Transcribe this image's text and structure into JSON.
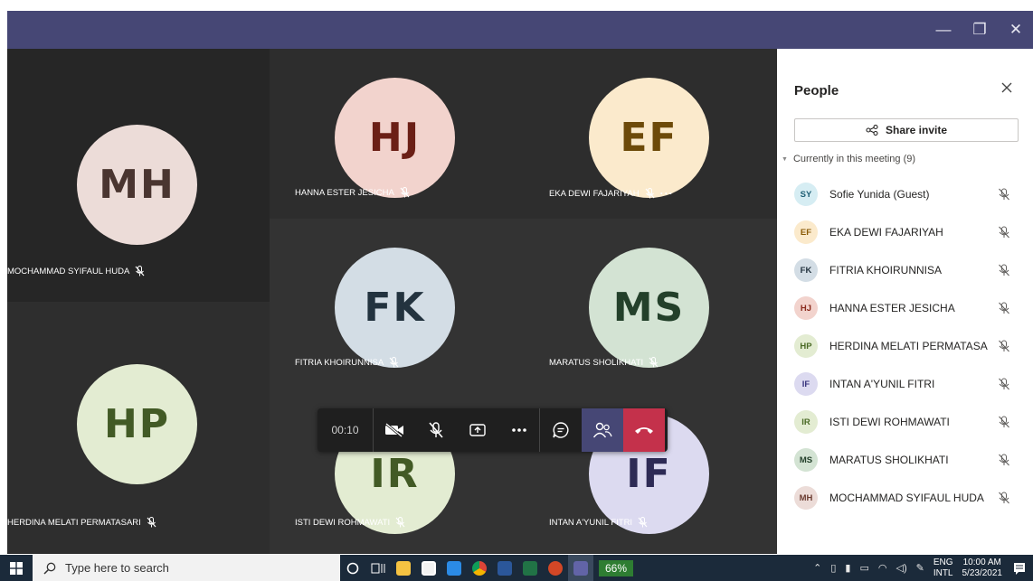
{
  "window": {
    "minimize": "—",
    "restore": "❐",
    "close": "✕"
  },
  "tiles": [
    {
      "initials": "MH",
      "name": "MOCHAMMAD SYIFAUL HUDA",
      "bg": "#262626",
      "circle": "#ecdcd8",
      "fg": "#4a3530"
    },
    {
      "initials": "HJ",
      "name": "HANNA ESTER JESICHA",
      "bg": "#2d2d2d",
      "circle": "#f2d3cd",
      "fg": "#6b1f16"
    },
    {
      "initials": "EF",
      "name": "EKA DEWI FAJARIYAH",
      "bg": "#2d2d2d",
      "circle": "#fbeacc",
      "fg": "#6d4a09"
    },
    {
      "initials": "FK",
      "name": "FITRIA KHOIRUNNISA",
      "bg": "#333333",
      "circle": "#d3dde5",
      "fg": "#23333f"
    },
    {
      "initials": "MS",
      "name": "MARATUS SHOLIKHATI",
      "bg": "#333333",
      "circle": "#d3e3d3",
      "fg": "#23402a"
    },
    {
      "initials": "HP",
      "name": "HERDINA MELATI PERMATASARI",
      "bg": "#2e2e2e",
      "circle": "#e3ecd2",
      "fg": "#425a25"
    },
    {
      "initials": "IR",
      "name": "ISTI DEWI ROHMAWATI",
      "bg": "#333333",
      "circle": "#e3ecd2",
      "fg": "#425a25"
    },
    {
      "initials": "IF",
      "name": "INTAN A'YUNIL FITRI",
      "bg": "#333333",
      "circle": "#dcdaf0",
      "fg": "#2d2a55"
    }
  ],
  "callbar": {
    "timer": "00:10"
  },
  "people": {
    "title": "People",
    "share_label": "Share invite",
    "section": "Currently in this meeting (9)",
    "members": [
      {
        "initials": "SY",
        "name": "Sofie Yunida (Guest)",
        "bg": "#d6edf3",
        "fg": "#1f5f75"
      },
      {
        "initials": "EF",
        "name": "EKA DEWI FAJARIYAH",
        "bg": "#fbeacc",
        "fg": "#8a5b06"
      },
      {
        "initials": "FK",
        "name": "FITRIA KHOIRUNNISA",
        "bg": "#d3dde5",
        "fg": "#23333f"
      },
      {
        "initials": "HJ",
        "name": "HANNA ESTER JESICHA",
        "bg": "#f2d3cd",
        "fg": "#8a2a1d"
      },
      {
        "initials": "HP",
        "name": "HERDINA MELATI PERMATASA",
        "bg": "#e3ecd2",
        "fg": "#4a6a25"
      },
      {
        "initials": "IF",
        "name": "INTAN A'YUNIL FITRI",
        "bg": "#dcdaf0",
        "fg": "#3a3680"
      },
      {
        "initials": "IR",
        "name": "ISTI DEWI ROHMAWATI",
        "bg": "#e3ecd2",
        "fg": "#4a6a25"
      },
      {
        "initials": "MS",
        "name": "MARATUS SHOLIKHATI",
        "bg": "#d3e3d3",
        "fg": "#23402a"
      },
      {
        "initials": "MH",
        "name": "MOCHAMMAD SYIFAUL HUDA",
        "bg": "#ecdcd8",
        "fg": "#6b3b30"
      }
    ]
  },
  "taskbar": {
    "search_placeholder": "Type here to search",
    "battery": "66%",
    "lang_top": "ENG",
    "lang_bottom": "INTL",
    "time": "10:00 AM",
    "date": "5/23/2021"
  }
}
